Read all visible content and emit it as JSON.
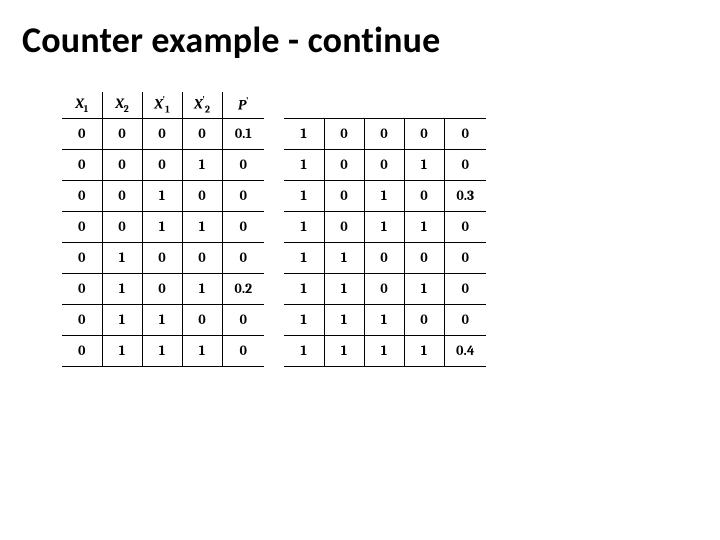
{
  "title": "Counter example - continue",
  "chart_data": [
    {
      "type": "table",
      "name": "left",
      "headers": [
        "X1",
        "X2",
        "X1'",
        "X2'",
        "P'"
      ],
      "rows": [
        [
          "0",
          "0",
          "0",
          "0",
          "0.1"
        ],
        [
          "0",
          "0",
          "0",
          "1",
          "0"
        ],
        [
          "0",
          "0",
          "1",
          "0",
          "0"
        ],
        [
          "0",
          "0",
          "1",
          "1",
          "0"
        ],
        [
          "0",
          "1",
          "0",
          "0",
          "0"
        ],
        [
          "0",
          "1",
          "0",
          "1",
          "0.2"
        ],
        [
          "0",
          "1",
          "1",
          "0",
          "0"
        ],
        [
          "0",
          "1",
          "1",
          "1",
          "0"
        ]
      ]
    },
    {
      "type": "table",
      "name": "right",
      "rows": [
        [
          "1",
          "0",
          "0",
          "0",
          "0"
        ],
        [
          "1",
          "0",
          "0",
          "1",
          "0"
        ],
        [
          "1",
          "0",
          "1",
          "0",
          "0.3"
        ],
        [
          "1",
          "0",
          "1",
          "1",
          "0"
        ],
        [
          "1",
          "1",
          "0",
          "0",
          "0"
        ],
        [
          "1",
          "1",
          "0",
          "1",
          "0"
        ],
        [
          "1",
          "1",
          "1",
          "0",
          "0"
        ],
        [
          "1",
          "1",
          "1",
          "1",
          "0.4"
        ]
      ]
    }
  ],
  "left_headers_html": {
    "h0": "X",
    "h0sub": "1",
    "h1": "X",
    "h1sub": "2",
    "h2": "X",
    "h2sup": "'",
    "h2sub": "1",
    "h3": "X",
    "h3sup": "'",
    "h3sub": "2",
    "h4": "P",
    "h4sup": "'"
  }
}
